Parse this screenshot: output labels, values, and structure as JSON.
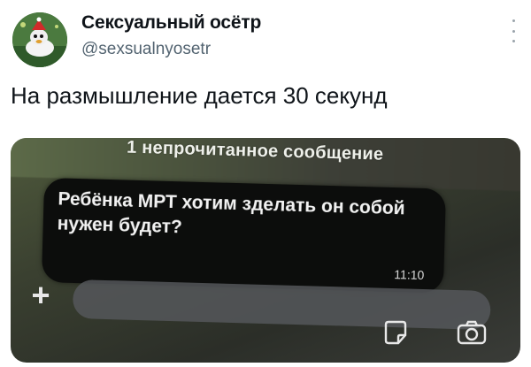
{
  "tweet": {
    "author": {
      "display_name": "Сексуальный осётр",
      "handle": "@sexsualnyosetr"
    },
    "text": "На размышление дается 30 секунд",
    "more_icon": "more-vertical-icon"
  },
  "photo": {
    "notification": "1 непрочитанное сообщение",
    "message": {
      "text": "Ребёнка МРТ хотим зделать он собой нужен будет?",
      "time": "11:10"
    },
    "icons": {
      "plus": "plus-icon",
      "sticker": "sticker-icon",
      "camera": "camera-icon"
    },
    "colors": {
      "bubble": "#0c0d0c",
      "banner": "#4c553e"
    }
  }
}
